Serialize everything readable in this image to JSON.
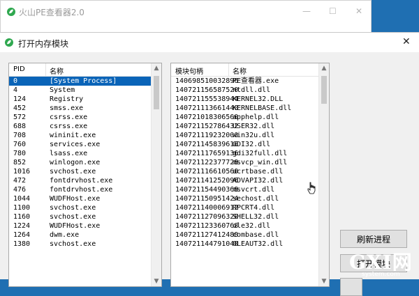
{
  "main_window": {
    "title": "火山PE查看器2.0",
    "minimize_glyph": "—",
    "maximize_glyph": "☐",
    "close_glyph": "✕"
  },
  "dialog": {
    "title": "打开内存模块",
    "close_glyph": "✕"
  },
  "process_list": {
    "columns": [
      "PID",
      "名称"
    ],
    "rows": [
      {
        "pid": "0",
        "name": "[System Process]",
        "selected": true
      },
      {
        "pid": "4",
        "name": "System"
      },
      {
        "pid": "124",
        "name": "Registry"
      },
      {
        "pid": "452",
        "name": "smss.exe"
      },
      {
        "pid": "572",
        "name": "csrss.exe"
      },
      {
        "pid": "688",
        "name": "csrss.exe"
      },
      {
        "pid": "708",
        "name": "wininit.exe"
      },
      {
        "pid": "760",
        "name": "services.exe"
      },
      {
        "pid": "780",
        "name": "lsass.exe"
      },
      {
        "pid": "852",
        "name": "winlogon.exe"
      },
      {
        "pid": "1016",
        "name": "svchost.exe"
      },
      {
        "pid": "472",
        "name": "fontdrvhost.exe"
      },
      {
        "pid": "476",
        "name": "fontdrvhost.exe"
      },
      {
        "pid": "1044",
        "name": "WUDFHost.exe"
      },
      {
        "pid": "1100",
        "name": "svchost.exe"
      },
      {
        "pid": "1160",
        "name": "svchost.exe"
      },
      {
        "pid": "1224",
        "name": "WUDFHost.exe"
      },
      {
        "pid": "1264",
        "name": "dwm.exe"
      },
      {
        "pid": "1380",
        "name": "svchost.exe"
      }
    ]
  },
  "module_list": {
    "columns": [
      "模块句柄",
      "名称"
    ],
    "rows": [
      {
        "handle": "140698510032896",
        "name": "PE查看器.exe"
      },
      {
        "handle": "140721156587520",
        "name": "ntdll.dll"
      },
      {
        "handle": "140721155538944",
        "name": "KERNEL32.DLL"
      },
      {
        "handle": "140721113661440",
        "name": "KERNELBASE.dll"
      },
      {
        "handle": "140721018306560",
        "name": "apphelp.dll"
      },
      {
        "handle": "140721152786432",
        "name": "USER32.dll"
      },
      {
        "handle": "140721119232000",
        "name": "win32u.dll"
      },
      {
        "handle": "140721145839616",
        "name": "GDI32.dll"
      },
      {
        "handle": "140721117659136",
        "name": "gdi32full.dll"
      },
      {
        "handle": "140721122377728",
        "name": "msvcp_win.dll"
      },
      {
        "handle": "140721116610560",
        "name": "ucrtbase.dll"
      },
      {
        "handle": "140721141252096",
        "name": "ADVAPI32.dll"
      },
      {
        "handle": "140721154490368",
        "name": "msvcrt.dll"
      },
      {
        "handle": "140721150951424",
        "name": "sechost.dll"
      },
      {
        "handle": "140721140006912",
        "name": "RPCRT4.dll"
      },
      {
        "handle": "140721127096320",
        "name": "SHELL32.dll"
      },
      {
        "handle": "140721123360768",
        "name": "ole32.dll"
      },
      {
        "handle": "140721127412480",
        "name": "combase.dll"
      },
      {
        "handle": "140721144791040",
        "name": "OLEAUT32.dll"
      }
    ]
  },
  "buttons": {
    "refresh": "刷新进程",
    "open": "打开模块",
    "third": ""
  },
  "watermark": {
    "logo": "GXI网",
    "sub": "system.com"
  },
  "colors": {
    "selection": "#0a64b8",
    "desktop": "#1f6fb2",
    "app_icon": "#2fa84f"
  },
  "icons": {
    "app_icon": "leaf-app-icon",
    "cursor": "hand-pointer-icon"
  }
}
